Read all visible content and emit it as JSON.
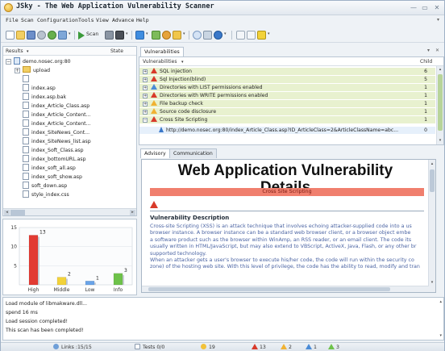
{
  "window": {
    "title": "JSky - The Web Application Vulnerability Scanner",
    "controls": [
      "minimize",
      "maximize",
      "close"
    ]
  },
  "menu": {
    "items": [
      "File",
      "Scan",
      "Configuration",
      "Tools",
      "View",
      "Advance",
      "Help"
    ]
  },
  "toolbar": {
    "scan_label": "Scan",
    "icons": [
      "new-icon",
      "open-icon",
      "save-icon",
      "settings-icon",
      "refresh-icon",
      "back-icon",
      "scan-icon",
      "pause-icon",
      "stop-icon",
      "crawler-icon",
      "fuzzer-icon",
      "plugin-icon",
      "globe-icon",
      "tool-icon",
      "help-icon",
      "layout-icon",
      "window-icon",
      "camera-icon"
    ]
  },
  "sites": {
    "header_results": "Results",
    "header_state": "State",
    "root": "demo.nosec.org:80",
    "folder": "upload",
    "files": [
      "",
      "index.asp",
      "index.asp.bak",
      "index_Article_Class.asp",
      "index_Article_Content...",
      "index_Article_Content...",
      "index_SiteNews_Cont...",
      "index_SiteNews_list.asp",
      "index_Soft_Class.asp",
      "index_bottomURL.asp",
      "index_soft_all.asp",
      "index_soft_show.asp",
      "soft_down.asp",
      "style_index.css"
    ]
  },
  "chart_data": {
    "type": "bar",
    "categories": [
      "High",
      "Middle",
      "Low",
      "Info"
    ],
    "values": [
      13,
      2,
      1,
      3
    ],
    "ylim": [
      0,
      15
    ],
    "yticks": [
      5,
      10,
      15
    ],
    "colors": [
      "#e23b33",
      "#f2d23a",
      "#6aa4e8",
      "#6ec24a"
    ],
    "grid": true
  },
  "vuln_pane": {
    "tab": "Vulnerabilities",
    "header_name": "Vulnerabilities",
    "header_child": "Child",
    "rows": [
      {
        "name": "SQL injection",
        "count": "6",
        "severity": "high"
      },
      {
        "name": "Sql Injection(blind)",
        "count": "5",
        "severity": "high"
      },
      {
        "name": "Directories with LIST permissions enabled",
        "count": "1",
        "severity": "low"
      },
      {
        "name": "Directories with WRITE permissions enabled",
        "count": "1",
        "severity": "high"
      },
      {
        "name": "File backup check",
        "count": "1",
        "severity": "middle"
      },
      {
        "name": "Source code disclosure",
        "count": "1",
        "severity": "middle"
      },
      {
        "name": "Cross Site Scripting",
        "count": "1",
        "severity": "high"
      }
    ],
    "child_row": {
      "url": "http://demo.nosec.org:80/index_Article_Class.asp?ID_ArticleClass=2&ArticleClassName=abc...",
      "count": "0"
    }
  },
  "detail": {
    "tabs": [
      "Advisory",
      "Communication"
    ],
    "title_line1": "Web Application Vulnerability",
    "title_line2": "Details",
    "vuln_name": "Cross Site Scripting",
    "section": "Vulnerability Description",
    "body": [
      "Cross-site Scripting (XSS) is an attack technique that involves echoing attacker-supplied code into a us",
      "browser instance. A browser instance can be a standard web browser client, or a browser object embe",
      "a software product such as the browser within WinAmp, an RSS reader, or an email client. The code its",
      "usually written in HTML/JavaScript, but may also extend to VBScript, ActiveX, Java, Flash, or any other br",
      "supported technology.",
      "When an attacker gets a user's browser to execute his/her code, the code will run within the security co",
      "zone) of the hosting web site. With this level of privilege, the code has the ability to read, modify and tran"
    ]
  },
  "log": {
    "lines": [
      "Load module of libmakware.dll...",
      "spend 16 ms",
      "Load session completed!",
      "This scan has been completed!"
    ]
  },
  "status": {
    "links": "Links :15/15",
    "tests": "Tests 0/0",
    "info": "19",
    "high": "13",
    "middle": "2",
    "low": "1",
    "other": "3"
  },
  "colors": {
    "row_highlight": "#e8f1cf",
    "advisory_bar": "#f07f6e",
    "high": "#d83a2a",
    "middle": "#f0b233",
    "low": "#4a8bd6"
  }
}
